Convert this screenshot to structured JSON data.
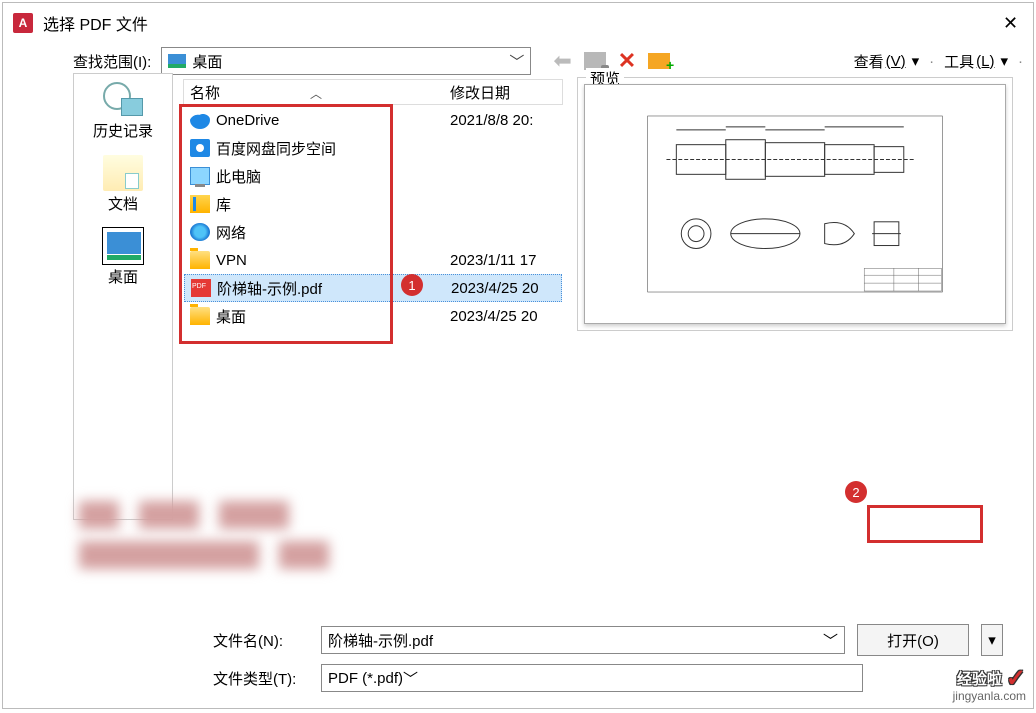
{
  "title": "选择 PDF 文件",
  "app_icon": "A",
  "lookin_label": "查找范围(I):",
  "lookin_value": "桌面",
  "nav": {
    "view_btn": "查看",
    "view_key": "(V)",
    "tools_btn": "工具",
    "tools_key": "(L)"
  },
  "sidebar": {
    "history": "历史记录",
    "documents": "文档",
    "desktop": "桌面"
  },
  "columns": {
    "name": "名称",
    "modified": "修改日期"
  },
  "files": [
    {
      "name": "OneDrive",
      "date": "2021/8/8 20:"
    },
    {
      "name": "百度网盘同步空间",
      "date": ""
    },
    {
      "name": "此电脑",
      "date": ""
    },
    {
      "name": "库",
      "date": ""
    },
    {
      "name": "网络",
      "date": ""
    },
    {
      "name": "VPN",
      "date": "2023/1/11 17"
    },
    {
      "name": "阶梯轴-示例.pdf",
      "date": "2023/4/25 20"
    },
    {
      "name": "桌面",
      "date": "2023/4/25 20"
    }
  ],
  "preview_label": "预览",
  "filename_label": "文件名(N):",
  "filename_value": "阶梯轴-示例.pdf",
  "filetype_label": "文件类型(T):",
  "filetype_value": "PDF (*.pdf)",
  "open_btn": "打开(O)",
  "badge1": "1",
  "badge2": "2",
  "watermark": {
    "main": "经验啦",
    "sub": "jingyanla.com"
  }
}
